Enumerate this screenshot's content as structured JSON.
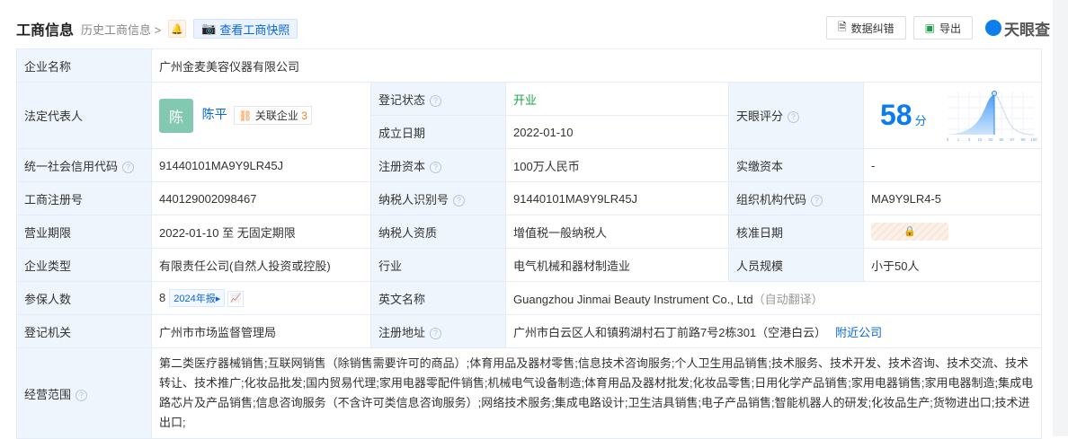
{
  "header": {
    "title": "工商信息",
    "history": "历史工商信息 >",
    "snapshot": "查看工商快照",
    "correct_btn": "数据纠错",
    "export_btn": "导出",
    "brand": "天眼查"
  },
  "rows": {
    "company_name": {
      "label": "企业名称",
      "value": "广州金麦美容仪器有限公司"
    },
    "legal_rep": {
      "label": "法定代表人",
      "avatar": "陈",
      "name": "陈平",
      "related_label": "关联企业",
      "related_count": "3"
    },
    "reg_status": {
      "label": "登记状态",
      "value": "开业"
    },
    "est_date": {
      "label": "成立日期",
      "value": "2022-01-10"
    },
    "score": {
      "label": "天眼评分",
      "value": "58",
      "unit": "分",
      "ticks": [
        "0",
        "1",
        "3",
        "15",
        "50",
        "85",
        "97",
        "99",
        "100"
      ]
    },
    "credit_code": {
      "label": "统一社会信用代码",
      "value": "91440101MA9Y9LR45J"
    },
    "reg_capital": {
      "label": "注册资本",
      "value": "100万人民币"
    },
    "paid_capital": {
      "label": "实缴资本",
      "value": "-"
    },
    "reg_no": {
      "label": "工商注册号",
      "value": "440129002098467"
    },
    "taxpayer_id": {
      "label": "纳税人识别号",
      "value": "91440101MA9Y9LR45J"
    },
    "org_code": {
      "label": "组织机构代码",
      "value": "MA9Y9LR4-5"
    },
    "term": {
      "label": "营业期限",
      "value": "2022-01-10 至 无固定期限"
    },
    "taxpayer_type": {
      "label": "纳税人资质",
      "value": "增值税一般纳税人"
    },
    "approve_date": {
      "label": "核准日期"
    },
    "company_type": {
      "label": "企业类型",
      "value": "有限责任公司(自然人投资或控股)"
    },
    "industry": {
      "label": "行业",
      "value": "电气机械和器材制造业"
    },
    "staff": {
      "label": "人员规模",
      "value": "小于50人"
    },
    "insured": {
      "label": "参保人数",
      "value": "8",
      "report": "2024年报"
    },
    "english": {
      "label": "英文名称",
      "value": "Guangzhou Jinmai Beauty Instrument Co., Ltd",
      "note": "（自动翻译）"
    },
    "authority": {
      "label": "登记机关",
      "value": "广州市市场监督管理局"
    },
    "address": {
      "label": "注册地址",
      "value": "广州市白云区人和镇鸦湖村石丁前路7号2栋301（空港白云）",
      "nearby": "附近公司"
    },
    "scope": {
      "label": "经营范围",
      "value": "第二类医疗器械销售;互联网销售（除销售需要许可的商品）;体育用品及器材零售;信息技术咨询服务;个人卫生用品销售;技术服务、技术开发、技术咨询、技术交流、技术转让、技术推广;化妆品批发;国内贸易代理;家用电器零配件销售;机械电气设备制造;体育用品及器材批发;化妆品零售;日用化学产品销售;家用电器销售;家用电器制造;集成电路芯片及产品销售;信息咨询服务（不含许可类信息咨询服务）;网络技术服务;集成电路设计;卫生洁具销售;电子产品销售;智能机器人的研发;化妆品生产;货物进出口;技术进出口;"
    }
  }
}
